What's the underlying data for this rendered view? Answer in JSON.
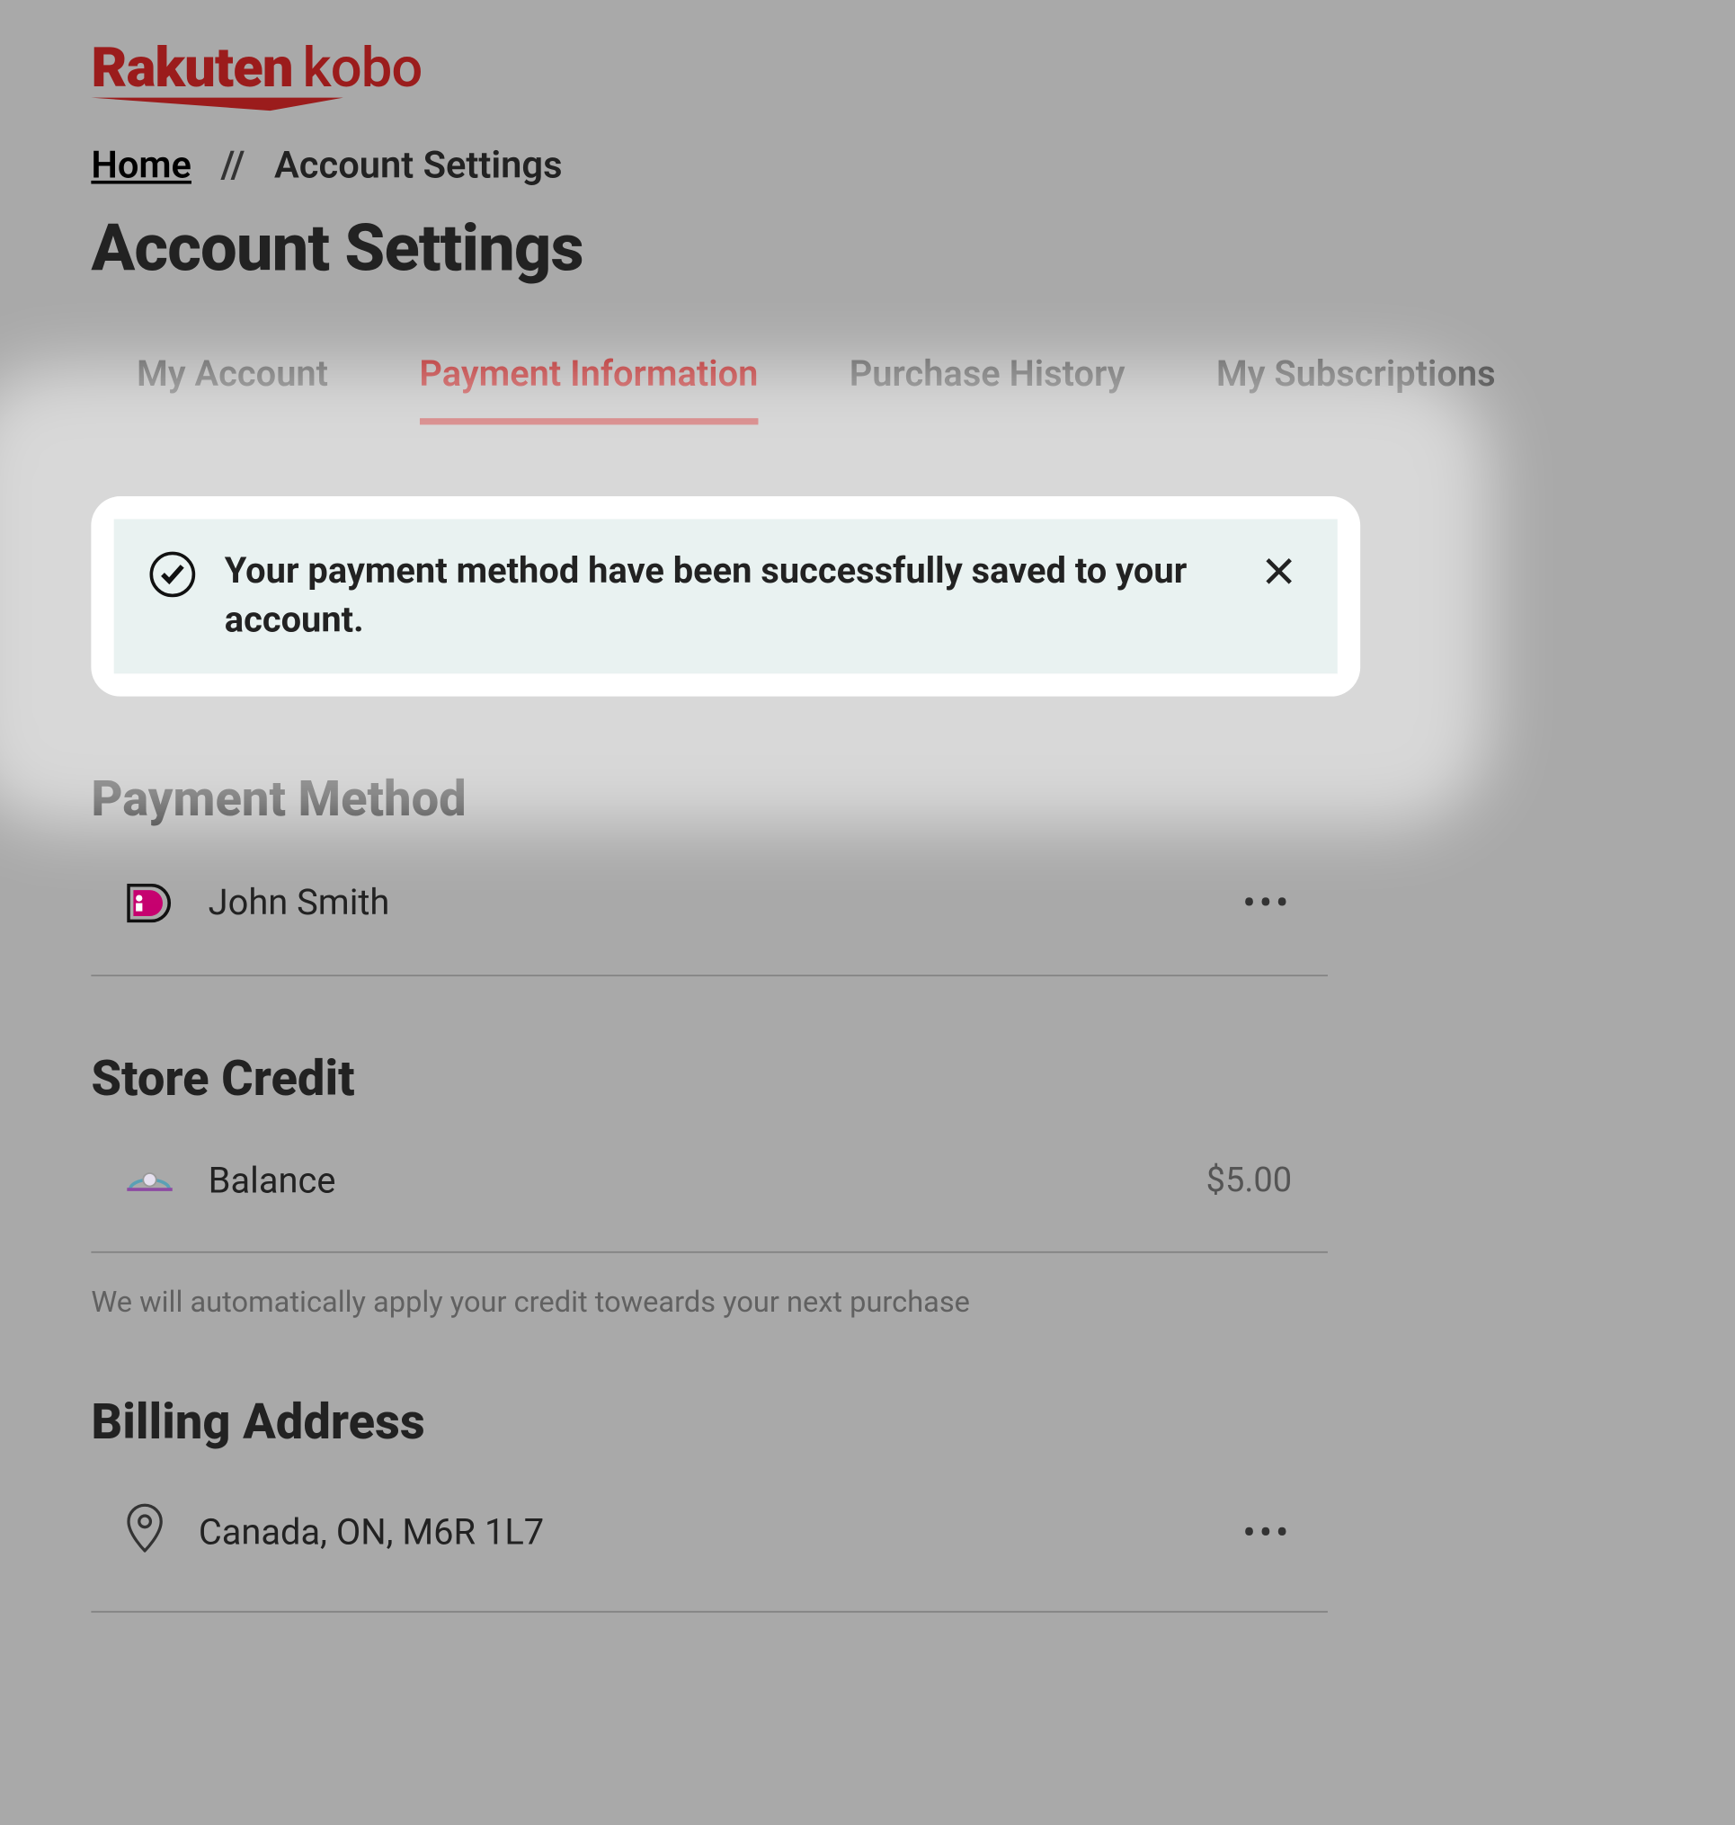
{
  "logo": {
    "brand1": "Rakuten",
    "brand2": "kobo"
  },
  "breadcrumb": {
    "home": "Home",
    "sep": "//",
    "current": "Account Settings"
  },
  "page_title": "Account Settings",
  "tabs": {
    "my_account": "My Account",
    "payment_info": "Payment Information",
    "purchase_history": "Purchase History",
    "my_subscriptions": "My Subscriptions"
  },
  "notification": {
    "message": "Your payment method have been successfully saved to your account."
  },
  "payment_method": {
    "heading": "Payment Method",
    "name": "John Smith"
  },
  "store_credit": {
    "heading": "Store Credit",
    "label": "Balance",
    "amount": "$5.00",
    "note": "We will automatically apply your credit toweards your next purchase"
  },
  "billing_address": {
    "heading": "Billing Address",
    "value": "Canada, ON, M6R 1L7"
  }
}
